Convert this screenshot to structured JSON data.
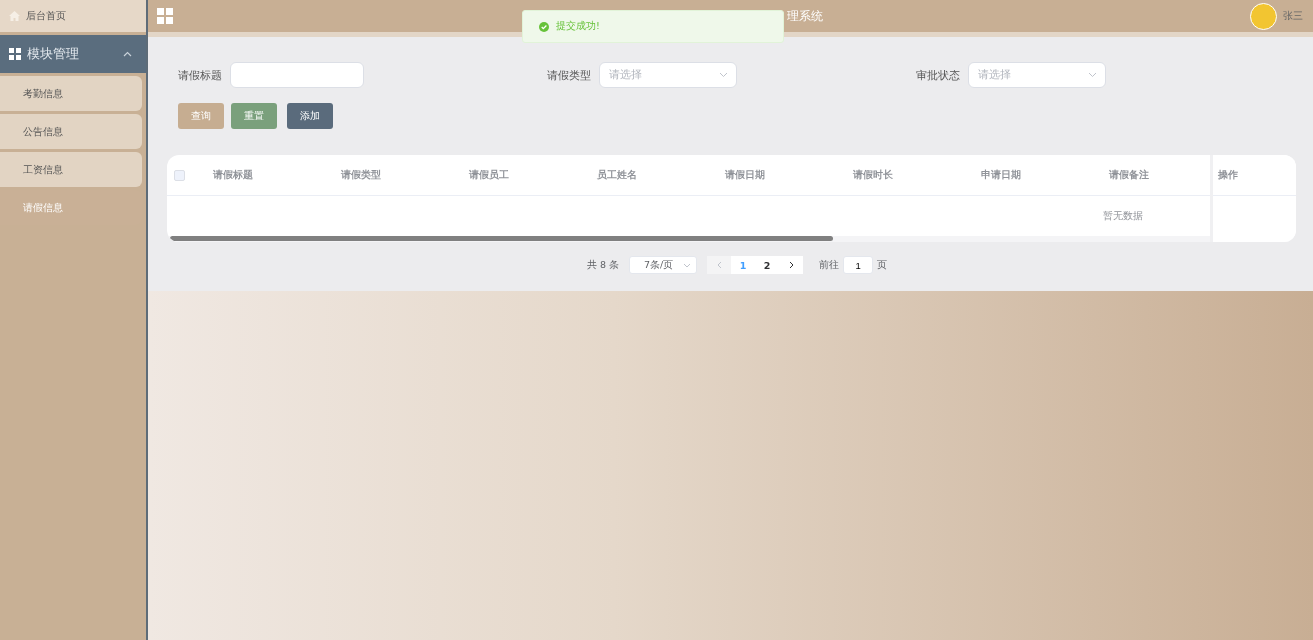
{
  "sidebar": {
    "home": {
      "label": "后台首页"
    },
    "groups": [
      {
        "label": "模块管理",
        "expanded": true,
        "children": [
          {
            "label": "考勤信息",
            "selected": false
          },
          {
            "label": "公告信息",
            "selected": false
          },
          {
            "label": "工资信息",
            "selected": false
          },
          {
            "label": "请假信息",
            "selected": true
          }
        ]
      }
    ]
  },
  "header": {
    "title": "理系统",
    "user": "张三"
  },
  "toast": {
    "message": "提交成功!"
  },
  "filters": [
    {
      "label": "请假标题",
      "kind": "input"
    },
    {
      "label": "请假类型",
      "kind": "select",
      "placeholder": "请选择"
    },
    {
      "label": "审批状态",
      "kind": "select",
      "placeholder": "请选择"
    }
  ],
  "buttons": [
    {
      "label": "查询",
      "kind": "search"
    },
    {
      "label": "重置",
      "kind": "reset"
    },
    {
      "label": "添加",
      "kind": "add"
    }
  ],
  "table": {
    "select_all_checked": false,
    "columns": [
      "请假标题",
      "请假类型",
      "请假员工",
      "员工姓名",
      "请假日期",
      "请假时长",
      "申请日期",
      "请假备注"
    ],
    "action_column": "操作",
    "empty_text": "暂无数据"
  },
  "pagination": {
    "total": "共 8 条",
    "page_size": "7条/页",
    "pages": [
      {
        "label": "1",
        "selected": true
      },
      {
        "label": "2",
        "selected": false
      }
    ],
    "goto_label": "前往",
    "goto_value": "1",
    "goto_suffix": "页"
  }
}
